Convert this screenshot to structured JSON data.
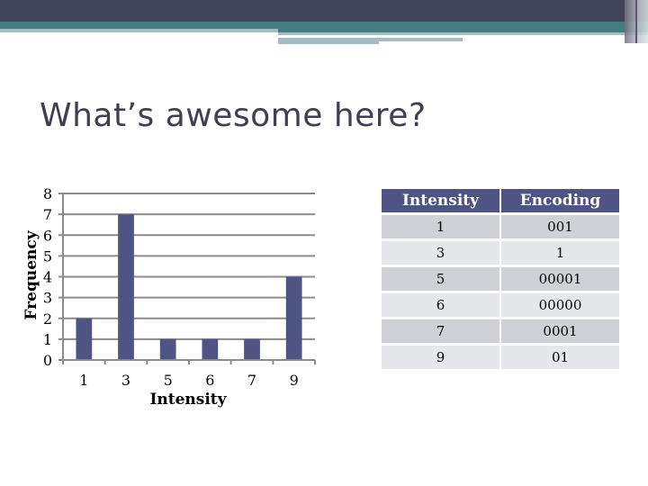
{
  "slide": {
    "title": "What’s awesome here?",
    "colors": {
      "header_dark": "#414356",
      "teal": "#457c80",
      "light_teal": "#a4bdc2",
      "bar": "#4e5585",
      "table_header": "#4e5585",
      "row_dark": "#d0d1d6",
      "row_light": "#e6e7ea"
    }
  },
  "chart_data": {
    "type": "bar",
    "categories": [
      "1",
      "3",
      "5",
      "6",
      "7",
      "9"
    ],
    "values": [
      2,
      7,
      1,
      1,
      1,
      4
    ],
    "title": "",
    "xlabel": "Intensity",
    "ylabel": "Frequency",
    "ylim": [
      0,
      8
    ],
    "yticks": [
      "0",
      "1",
      "2",
      "3",
      "4",
      "5",
      "6",
      "7",
      "8"
    ],
    "grid": true,
    "legend": "none"
  },
  "table": {
    "headers": [
      "Intensity",
      "Encoding"
    ],
    "rows": [
      [
        "1",
        "001"
      ],
      [
        "3",
        "1"
      ],
      [
        "5",
        "00001"
      ],
      [
        "6",
        "00000"
      ],
      [
        "7",
        "0001"
      ],
      [
        "9",
        "01"
      ]
    ]
  }
}
